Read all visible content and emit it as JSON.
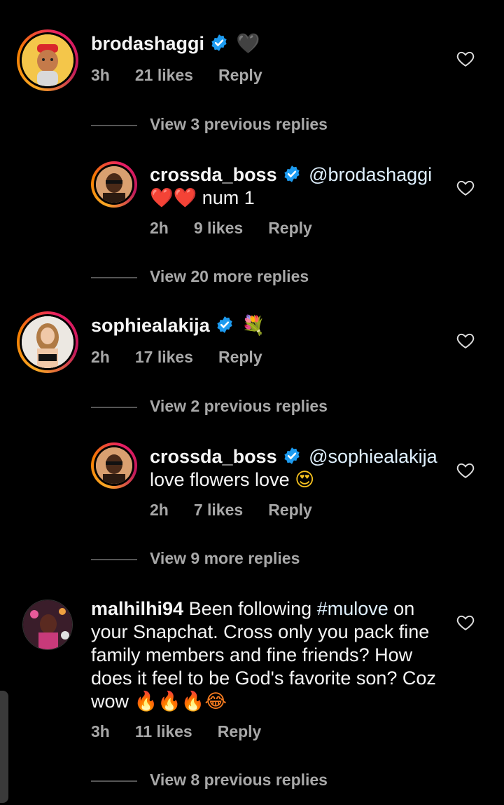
{
  "comments": [
    {
      "username": "brodashaggi",
      "text_emoji": "🖤",
      "time": "3h",
      "likes": "21 likes",
      "reply": "Reply",
      "thread_label": "View 3 previous replies"
    },
    {
      "username": "crossda_boss",
      "mention": "@brodashaggi",
      "text_emoji": "❤️❤️",
      "text": "num 1",
      "time": "2h",
      "likes": "9 likes",
      "reply": "Reply",
      "thread_label": "View 20 more replies"
    },
    {
      "username": "sophiealakija",
      "text_emoji": "💐",
      "time": "2h",
      "likes": "17 likes",
      "reply": "Reply",
      "thread_label": "View 2 previous replies"
    },
    {
      "username": "crossda_boss",
      "mention": "@sophiealakija",
      "text": "love flowers love",
      "text_emoji": "😍",
      "time": "2h",
      "likes": "7 likes",
      "reply": "Reply",
      "thread_label": "View 9 more replies"
    },
    {
      "username": "malhilhi94",
      "text_before": "Been following",
      "hashtag": "#mulove",
      "text_after": "on your Snapchat. Cross only you pack fine family members and fine friends? How does it feel to be God's favorite son? Coz wow",
      "text_emoji": "🔥🔥🔥😂",
      "time": "3h",
      "likes": "11 likes",
      "reply": "Reply",
      "thread_label": "View 8 previous replies"
    }
  ],
  "icons": {
    "verified": "verified-badge-icon",
    "like": "heart-outline-icon"
  },
  "colors": {
    "background": "#000000",
    "text": "#f5f5f5",
    "secondary": "#a8a8a8",
    "verified": "#1d9bf0",
    "mention": "#e0f1ff"
  }
}
